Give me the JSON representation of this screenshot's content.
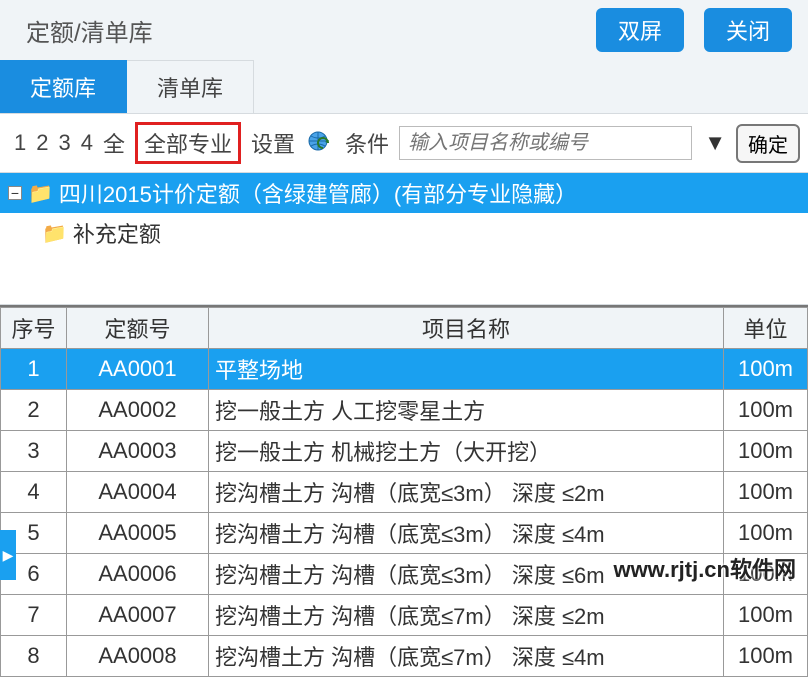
{
  "header": {
    "title": "定额/清单库",
    "dual_screen": "双屏",
    "close": "关闭"
  },
  "tabs": {
    "quota": "定额库",
    "list": "清单库"
  },
  "toolbar": {
    "n1": "1",
    "n2": "2",
    "n3": "3",
    "n4": "4",
    "all_short": "全",
    "all_major": "全部专业",
    "settings": "设置",
    "conditions": "条件",
    "search_placeholder": "输入项目名称或编号",
    "confirm": "确定"
  },
  "tree": {
    "root": "四川2015计价定额（含绿建管廊）(有部分专业隐藏）",
    "child": "补充定额"
  },
  "table": {
    "headers": {
      "no": "序号",
      "code": "定额号",
      "name": "项目名称",
      "unit": "单位"
    },
    "rows": [
      {
        "no": "1",
        "code": "AA0001",
        "name": "平整场地",
        "unit": "100m"
      },
      {
        "no": "2",
        "code": "AA0002",
        "name": "挖一般土方 人工挖零星土方",
        "unit": "100m"
      },
      {
        "no": "3",
        "code": "AA0003",
        "name": "挖一般土方 机械挖土方（大开挖）",
        "unit": "100m"
      },
      {
        "no": "4",
        "code": "AA0004",
        "name": "挖沟槽土方 沟槽（底宽≤3m） 深度 ≤2m",
        "unit": "100m"
      },
      {
        "no": "5",
        "code": "AA0005",
        "name": "挖沟槽土方 沟槽（底宽≤3m） 深度 ≤4m",
        "unit": "100m"
      },
      {
        "no": "6",
        "code": "AA0006",
        "name": "挖沟槽土方 沟槽（底宽≤3m） 深度 ≤6m",
        "unit": "100m"
      },
      {
        "no": "7",
        "code": "AA0007",
        "name": "挖沟槽土方 沟槽（底宽≤7m） 深度 ≤2m",
        "unit": "100m"
      },
      {
        "no": "8",
        "code": "AA0008",
        "name": "挖沟槽土方 沟槽（底宽≤7m） 深度 ≤4m",
        "unit": "100m"
      }
    ]
  },
  "watermark": "www.rjtj.cn软件网"
}
